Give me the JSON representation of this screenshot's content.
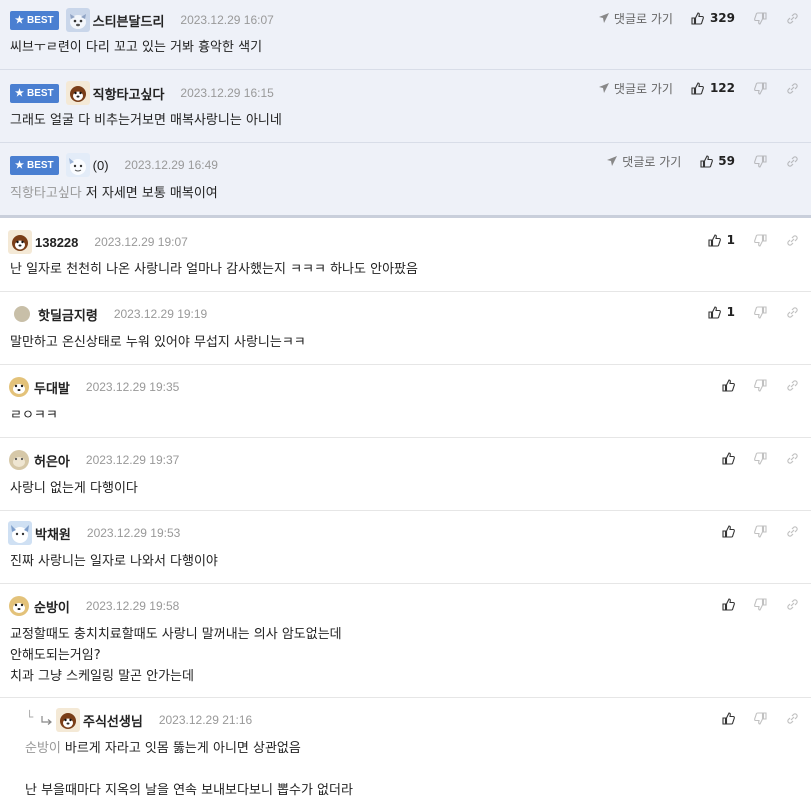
{
  "best_badge": "BEST",
  "reply_link_label": "댓글로 가기",
  "comments": [
    {
      "nick": "스티븐달드리",
      "date": "2023.12.29 16:07",
      "likes": "329",
      "mention": "",
      "text": "씨브ㅜㄹ련이 다리 꼬고 있는 거봐 흉악한 색기"
    },
    {
      "nick": "직항타고싶다",
      "date": "2023.12.29 16:15",
      "likes": "122",
      "mention": "",
      "text": "그래도 얼굴 다 비추는거보면 매복사랑니는 아니네"
    },
    {
      "nick": "(0)",
      "date": "2023.12.29 16:49",
      "likes": "59",
      "mention": "직항타고싶다",
      "text": "저 자세면 보통 매복이여"
    },
    {
      "nick": "138228",
      "date": "2023.12.29 19:07",
      "likes": "1",
      "mention": "",
      "text": "난 일자로 천천히 나온 사랑니라 얼마나 감사했는지 ㅋㅋㅋ 하나도 안아팠음"
    },
    {
      "nick": "핫딜금지령",
      "date": "2023.12.29 19:19",
      "likes": "1",
      "mention": "",
      "text": "말만하고 온신상태로 누워 있어야 무섭지 사랑니는ㅋㅋ"
    },
    {
      "nick": "두대발",
      "date": "2023.12.29 19:35",
      "likes": "",
      "mention": "",
      "text": "ㄹㅇㅋㅋ"
    },
    {
      "nick": "허은아",
      "date": "2023.12.29 19:37",
      "likes": "",
      "mention": "",
      "text": "사랑니 없는게 다행이다"
    },
    {
      "nick": "박채원",
      "date": "2023.12.29 19:53",
      "likes": "",
      "mention": "",
      "text": "진짜 사랑니는 일자로 나와서 다행이야"
    },
    {
      "nick": "순방이",
      "date": "2023.12.29 19:58",
      "likes": "",
      "mention": "",
      "line1": "교정할때도 충치치료할때도 사랑니 말꺼내는 의사 암도없는데",
      "line2": "안해도되는거임?",
      "line3": "치과 그냥 스케일링 말곤 안가는데"
    },
    {
      "nick": "주식선생님",
      "date": "2023.12.29 21:16",
      "likes": "",
      "mention": "순방이",
      "text": "바르게 자라고 잇몸 뚫는게 아니면 상관없음",
      "text2": "난 부을때마다 지옥의 날을 연속 보내보다보니 뽑수가 없더라"
    }
  ]
}
